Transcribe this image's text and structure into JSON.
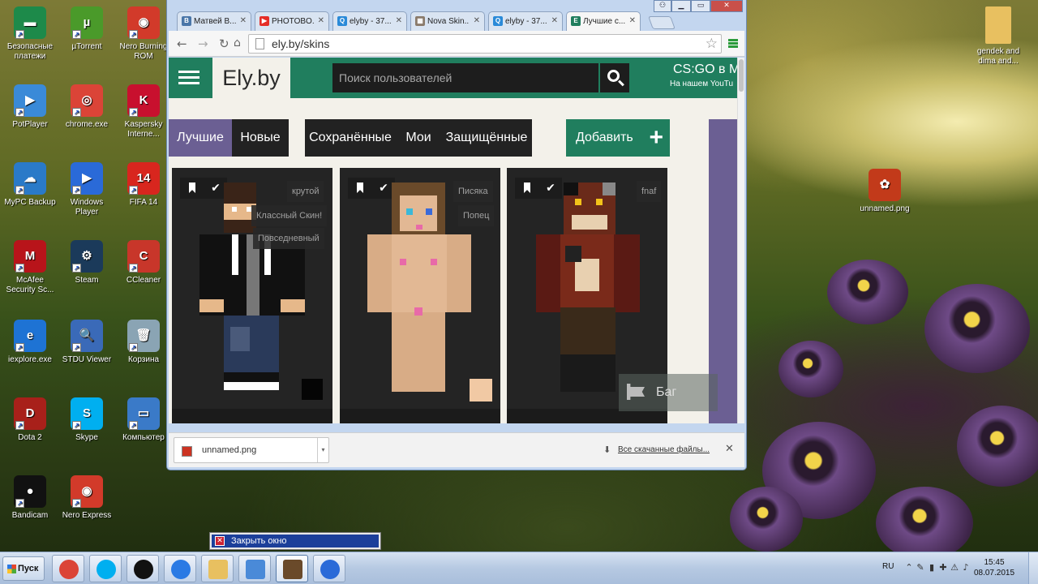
{
  "desktop": {
    "icons": [
      {
        "label": "Безопасные платежи",
        "icon": "safe-payments-icon",
        "color": "#1d8a4a",
        "glyph": "▬"
      },
      {
        "label": "µTorrent",
        "icon": "utorrent-icon",
        "color": "#4a9a2a",
        "glyph": "µ"
      },
      {
        "label": "Nero Burning ROM",
        "icon": "nero-icon",
        "color": "#d23a2a",
        "glyph": "◉"
      },
      {
        "label": "PotPlayer",
        "icon": "potplayer-icon",
        "color": "#3a8ad8",
        "glyph": "▶"
      },
      {
        "label": "chrome.exe",
        "icon": "chrome-icon",
        "color": "#db4437",
        "glyph": "◎"
      },
      {
        "label": "Kaspersky Interne...",
        "icon": "kaspersky-icon",
        "color": "#c8102e",
        "glyph": "K"
      },
      {
        "label": "MyPC Backup",
        "icon": "mypc-backup-icon",
        "color": "#2a7ac8",
        "glyph": "☁"
      },
      {
        "label": "Windows Player",
        "icon": "windows-media-player-icon",
        "color": "#2a6ad8",
        "glyph": "▶"
      },
      {
        "label": "FIFA 14",
        "icon": "fifa-icon",
        "color": "#d8261e",
        "glyph": "14"
      },
      {
        "label": "McAfee Security Sc...",
        "icon": "mcafee-icon",
        "color": "#b8141a",
        "glyph": "M"
      },
      {
        "label": "Steam",
        "icon": "steam-icon",
        "color": "#1b3a5a",
        "glyph": "⚙"
      },
      {
        "label": "CCleaner",
        "icon": "ccleaner-icon",
        "color": "#c8362a",
        "glyph": "C"
      },
      {
        "label": "iexplore.exe",
        "icon": "internet-explorer-icon",
        "color": "#1e73d4",
        "glyph": "e"
      },
      {
        "label": "STDU Viewer",
        "icon": "stdu-viewer-icon",
        "color": "#3a6ab8",
        "glyph": "🔍"
      },
      {
        "label": "Корзина",
        "icon": "recycle-bin-icon",
        "color": "#8aa4b4",
        "glyph": "🗑"
      },
      {
        "label": "Dota 2",
        "icon": "dota2-icon",
        "color": "#a8201a",
        "glyph": "D"
      },
      {
        "label": "Skype",
        "icon": "skype-icon",
        "color": "#00aff0",
        "glyph": "S"
      },
      {
        "label": "Компьютер",
        "icon": "computer-icon",
        "color": "#3a7ac8",
        "glyph": "▭"
      },
      {
        "label": "Bandicam",
        "icon": "bandicam-icon",
        "color": "#111111",
        "glyph": "●"
      },
      {
        "label": "Nero Express",
        "icon": "nero-express-icon",
        "color": "#d23a2a",
        "glyph": "◉"
      },
      {
        "label": "gendek and dima and...",
        "icon": "folder-icon",
        "color": "#e8c060",
        "glyph": ""
      },
      {
        "label": "unnamed.png",
        "icon": "image-file-icon",
        "color": "#c23a1a",
        "glyph": "✿"
      }
    ]
  },
  "browser": {
    "tabs": [
      {
        "title": "Матвей В...",
        "icon": "vk-icon",
        "color": "#4a76a8",
        "glyph": "B"
      },
      {
        "title": "PHOTOBO...",
        "icon": "youtube-icon",
        "color": "#e52d27",
        "glyph": "▶"
      },
      {
        "title": "elyby - 37...",
        "icon": "search-engine-icon",
        "color": "#2a8ad8",
        "glyph": "Q"
      },
      {
        "title": "Nova Skin...",
        "icon": "nova-skin-icon",
        "color": "#8a7a6a",
        "glyph": "▦"
      },
      {
        "title": "elyby - 37...",
        "icon": "search-engine-icon",
        "color": "#2a8ad8",
        "glyph": "Q"
      },
      {
        "title": "Лучшие с...",
        "icon": "elyby-icon",
        "color": "#207e5e",
        "glyph": "E"
      }
    ],
    "url": "ely.by/skins",
    "window_controls": {
      "user": "⚇",
      "minimize": "▁",
      "maximize": "▭",
      "close": "✕"
    }
  },
  "site": {
    "logo": "Ely.by",
    "search_placeholder": "Поиск пользователей",
    "promo_title": "CS:GO в Mi",
    "promo_subtitle": "На нашем YouTu",
    "filters_left": [
      {
        "label": "Лучшие",
        "active": true
      },
      {
        "label": "Новые",
        "active": false
      }
    ],
    "filters_right": [
      "Сохранённые",
      "Мои",
      "Защищённые"
    ],
    "add_button": "Добавить",
    "add_icon": "+",
    "check_glyph": "✔",
    "bug_tracker": "Баг трекер",
    "skins": [
      {
        "tags": [
          "крутой",
          "Классный Скин!",
          "Повседневный"
        ]
      },
      {
        "tags": [
          "Писяка",
          "Попец"
        ]
      },
      {
        "tags": [
          "fnaf"
        ]
      }
    ]
  },
  "downloads": {
    "file": "unnamed.png",
    "show_all": "Все скачанные файлы...",
    "arrow": "⬇",
    "close": "✕",
    "dropdown": "▾"
  },
  "tooltip": {
    "label": "Закрыть окно",
    "icon": "✕"
  },
  "taskbar": {
    "start_label": "Пуск",
    "apps": [
      {
        "name": "chrome-taskbar-icon",
        "color": "#db4437"
      },
      {
        "name": "skype-taskbar-icon",
        "color": "#00aff0"
      },
      {
        "name": "bandicam-taskbar-icon",
        "color": "#111111"
      },
      {
        "name": "media-center-taskbar-icon",
        "color": "#2a7ae4"
      },
      {
        "name": "explorer-taskbar-icon",
        "color": "#e8c060"
      },
      {
        "name": "image-viewer-taskbar-icon",
        "color": "#4a8ad8"
      },
      {
        "name": "minecraft-taskbar-icon",
        "color": "#6a4a2a"
      },
      {
        "name": "windows-media-player-taskbar-icon",
        "color": "#2a6ad8"
      }
    ],
    "lang": "RU",
    "tray_glyphs": [
      "⌃",
      "✎",
      "▮",
      "✚",
      "⚠",
      "♪"
    ],
    "time": "15:45",
    "date": "08.07.2015"
  }
}
